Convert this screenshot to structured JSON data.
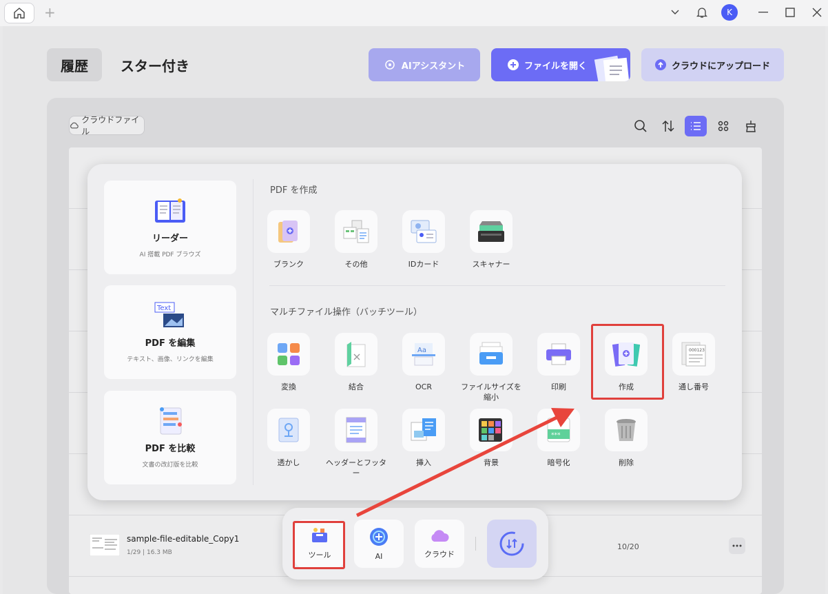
{
  "tabs": {
    "add": "+"
  },
  "header": {
    "history": "履歴",
    "starred": "スター付き",
    "ai_assistant": "AIアシスタント",
    "open_file": "ファイルを開く",
    "upload": "クラウドにアップロード"
  },
  "toolbar": {
    "cloud_files": "クラウドファイル"
  },
  "user": {
    "avatar_letter": "K"
  },
  "popup": {
    "cards": [
      {
        "title": "リーダー",
        "subtitle": "AI 搭載 PDF ブラウズ"
      },
      {
        "title": "PDF を編集",
        "subtitle": "テキスト、画像、リンクを編集"
      },
      {
        "title": "PDF を比較",
        "subtitle": "文書の改訂版を比較"
      }
    ],
    "section_create": "PDF を作成",
    "create_tools": [
      "ブランク",
      "その他",
      "IDカード",
      "スキャナー"
    ],
    "section_batch": "マルチファイル操作（バッチツール）",
    "batch_tools": [
      "変換",
      "結合",
      "OCR",
      "ファイルサイズを縮小",
      "印刷",
      "作成",
      "通し番号",
      "透かし",
      "ヘッダーとフッター",
      "挿入",
      "背景",
      "暗号化",
      "削除"
    ]
  },
  "file": {
    "name": "sample-file-editable_Copy1",
    "meta": "1/29 | 16.3 MB",
    "pages": "10/20"
  },
  "dock": {
    "tools": "ツール",
    "ai": "AI",
    "cloud": "クラウド"
  },
  "colors": {
    "accent": "#6c6cf5",
    "highlight": "#e0403c"
  }
}
